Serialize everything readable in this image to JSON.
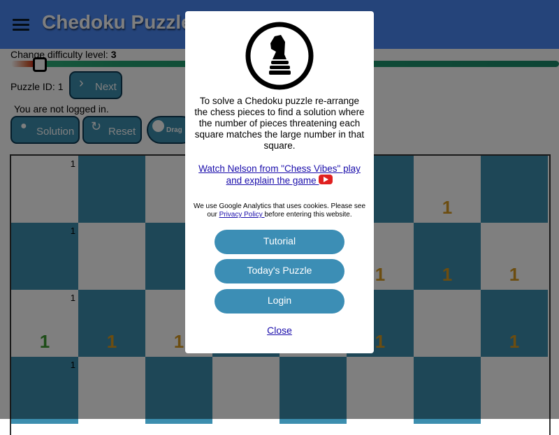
{
  "header": {
    "title": "Chedoku Puzzle",
    "menu_icon": "hamburger-icon"
  },
  "difficulty": {
    "label": "Change difficulty level: ",
    "value": "3",
    "level_fraction": 0.05
  },
  "puzzle": {
    "id_label": "Puzzle ID: ",
    "id": "1"
  },
  "buttons": {
    "next": "Next",
    "solution": "Solution",
    "reset": "Reset",
    "drag": "Drag"
  },
  "status": {
    "login": "You are not logged in."
  },
  "board": {
    "colors": {
      "small": "#000000",
      "orange": "#d89a20",
      "green": "#3c9a30"
    },
    "cells": [
      {
        "r": 0,
        "c": 0,
        "small": "1"
      },
      {
        "r": 1,
        "c": 0,
        "small": "1"
      },
      {
        "r": 2,
        "c": 0,
        "small": "1",
        "big": "1",
        "big_color": "green"
      },
      {
        "r": 3,
        "c": 0,
        "small": "1"
      },
      {
        "r": 0,
        "c": 6,
        "big": "1",
        "big_color": "orange"
      },
      {
        "r": 1,
        "c": 5,
        "big": "1",
        "big_color": "orange"
      },
      {
        "r": 1,
        "c": 6,
        "big": "1",
        "big_color": "orange"
      },
      {
        "r": 1,
        "c": 7,
        "big": "1",
        "big_color": "orange"
      },
      {
        "r": 2,
        "c": 1,
        "big": "1",
        "big_color": "orange"
      },
      {
        "r": 2,
        "c": 2,
        "big": "1",
        "big_color": "orange"
      },
      {
        "r": 2,
        "c": 5,
        "big": "1",
        "big_color": "orange"
      },
      {
        "r": 2,
        "c": 7,
        "big": "1",
        "big_color": "orange"
      }
    ]
  },
  "modal": {
    "logo_icon": "chess-knight-icon",
    "intro": "To solve a Chedoku puzzle re-arrange the chess pieces to find a solution where the number of pieces threatening each square matches the large number in that square.",
    "video_link": "Watch Nelson from \"Chess Vibes\" play and explain the game ",
    "cookies_pre": "We use Google Analytics that uses cookies. Please see our ",
    "privacy_link": "Privacy Policy ",
    "cookies_post": "before entering this website.",
    "buttons": [
      "Tutorial",
      "Today's Puzzle",
      "Login"
    ],
    "close": "Close"
  }
}
